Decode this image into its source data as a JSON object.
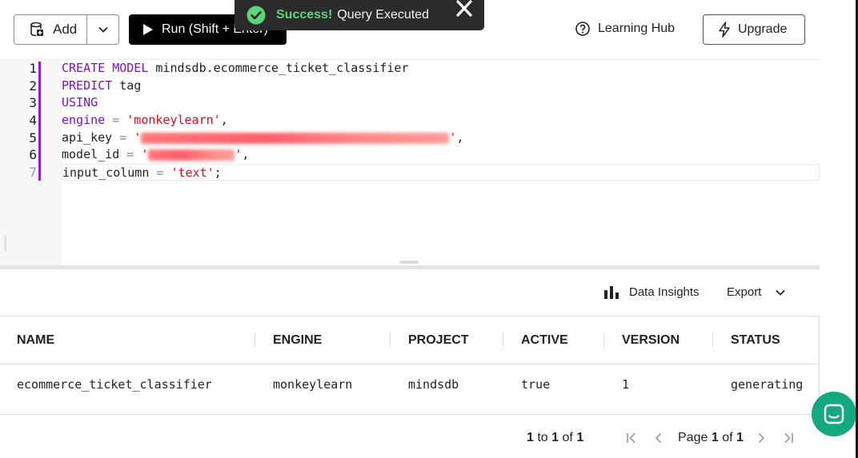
{
  "toolbar": {
    "add_label": "Add",
    "run_label": "Run (Shift + Enter)",
    "learning_hub_label": "Learning Hub",
    "upgrade_label": "Upgrade"
  },
  "toast": {
    "title": "Success!",
    "message": "Query Executed"
  },
  "editor": {
    "line_numbers": [
      "1",
      "2",
      "3",
      "4",
      "5",
      "6",
      "7"
    ],
    "lines": {
      "l1": "CREATE MODEL mindsdb.ecommerce_ticket_classifier",
      "l2": "PREDICT tag",
      "l3": "USING",
      "l4_key": "engine",
      "l4_val": "'monkeylearn'",
      "l5_key": "api_key",
      "l6_key": "model_id",
      "l7_key": "input_column",
      "l7_val": "'text'"
    }
  },
  "results": {
    "data_insights_label": "Data Insights",
    "export_label": "Export",
    "columns": [
      "NAME",
      "ENGINE",
      "PROJECT",
      "ACTIVE",
      "VERSION",
      "STATUS"
    ],
    "rows": [
      [
        "ecommerce_ticket_classifier",
        "monkeylearn",
        "mindsdb",
        "true",
        "1",
        "generating"
      ]
    ],
    "pagination": {
      "range_from": "1",
      "range_to": "1",
      "range_total": "1",
      "range_to_word": "to",
      "range_of_word": "of",
      "page_word": "Page",
      "page_current": "1",
      "page_of_word": "of",
      "page_total": "1"
    }
  },
  "colors": {
    "accent_purple": "#7d10c8",
    "string_red": "#d0101f",
    "success_green": "#5fd37a",
    "chat_green": "#13a87e"
  }
}
